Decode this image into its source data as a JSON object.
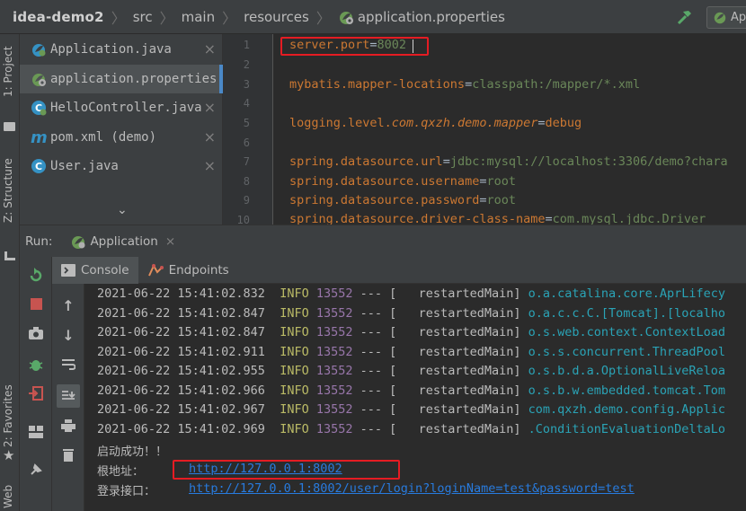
{
  "breadcrumb": [
    "idea-demo2",
    "src",
    "main",
    "resources",
    "application.properties"
  ],
  "run_config_label": "Ap",
  "sidebar": {
    "project_label": "1: Project",
    "structure_label": "Z: Structure",
    "favorites_label": "2: Favorites",
    "web_label": "Web"
  },
  "file_tabs": [
    {
      "name": "Application.java",
      "icon": "spring-boot-icon"
    },
    {
      "name": "application.properties",
      "icon": "spring-properties-icon",
      "active": true
    },
    {
      "name": "HelloController.java",
      "icon": "class-icon"
    },
    {
      "name": "pom.xml (demo)",
      "icon": "maven-icon"
    },
    {
      "name": "User.java",
      "icon": "class-icon"
    }
  ],
  "line_numbers": [
    "1",
    "2",
    "3",
    "4",
    "5",
    "6",
    "7",
    "8",
    "9",
    "10"
  ],
  "code": {
    "l1_key": "server.port",
    "l1_eq": "=",
    "l1_val": "8002",
    "l3_key": "mybatis.mapper-locations",
    "l3_eq": "=",
    "l3_val": "classpath:/mapper/*.xml",
    "l5_key_a": "logging.level.",
    "l5_key_b": "com.qxzh.demo.mapper",
    "l5_eq": "=",
    "l5_val": "debug",
    "l7_key": "spring.datasource.url",
    "l7_eq": "=",
    "l7_val": "jdbc:mysql://localhost:3306/demo?chara",
    "l8_key": "spring.datasource.username",
    "l8_eq": "=",
    "l8_val": "root",
    "l9_key": "spring.datasource.password",
    "l9_eq": "=",
    "l9_val": "root",
    "l10_key": "spring.datasource.driver-class-name",
    "l10_eq": "=",
    "l10_val": "com.mysql.jdbc.Driver"
  },
  "run_panel": {
    "title": "Run:",
    "app_tab": "Application",
    "console_tab": "Console",
    "endpoints_tab": "Endpoints"
  },
  "log_lines": [
    {
      "ts": "2021-06-22 15:41:02.832",
      "level": "INFO",
      "pid": "13552",
      "sep": "--- [",
      "thread": "  restartedMain]",
      "logger": "o.a.catalina.core.AprLifecy"
    },
    {
      "ts": "2021-06-22 15:41:02.847",
      "level": "INFO",
      "pid": "13552",
      "sep": "--- [",
      "thread": "  restartedMain]",
      "logger": "o.a.c.c.C.[Tomcat].[localho"
    },
    {
      "ts": "2021-06-22 15:41:02.847",
      "level": "INFO",
      "pid": "13552",
      "sep": "--- [",
      "thread": "  restartedMain]",
      "logger": "o.s.web.context.ContextLoad"
    },
    {
      "ts": "2021-06-22 15:41:02.911",
      "level": "INFO",
      "pid": "13552",
      "sep": "--- [",
      "thread": "  restartedMain]",
      "logger": "o.s.s.concurrent.ThreadPool"
    },
    {
      "ts": "2021-06-22 15:41:02.955",
      "level": "INFO",
      "pid": "13552",
      "sep": "--- [",
      "thread": "  restartedMain]",
      "logger": "o.s.b.d.a.OptionalLiveReloa"
    },
    {
      "ts": "2021-06-22 15:41:02.966",
      "level": "INFO",
      "pid": "13552",
      "sep": "--- [",
      "thread": "  restartedMain]",
      "logger": "o.s.b.w.embedded.tomcat.Tom"
    },
    {
      "ts": "2021-06-22 15:41:02.967",
      "level": "INFO",
      "pid": "13552",
      "sep": "--- [",
      "thread": "  restartedMain]",
      "logger": "com.qxzh.demo.config.Applic"
    },
    {
      "ts": "2021-06-22 15:41:02.969",
      "level": "INFO",
      "pid": "13552",
      "sep": "--- [",
      "thread": "  restartedMain]",
      "logger": ".ConditionEvaluationDeltaLo"
    }
  ],
  "startup": {
    "success_msg": "启动成功！！",
    "root_label": "根地址：",
    "root_url": "http://127.0.0.1:8002",
    "login_label": "登录接口：",
    "login_url": "http://127.0.0.1:8002/user/login?loginName=test&password=test"
  },
  "colors": {
    "highlight_box": "#e51c23",
    "key": "#cc7832",
    "value": "#6a8759",
    "link": "#287bde",
    "info": "#bbbb66"
  }
}
